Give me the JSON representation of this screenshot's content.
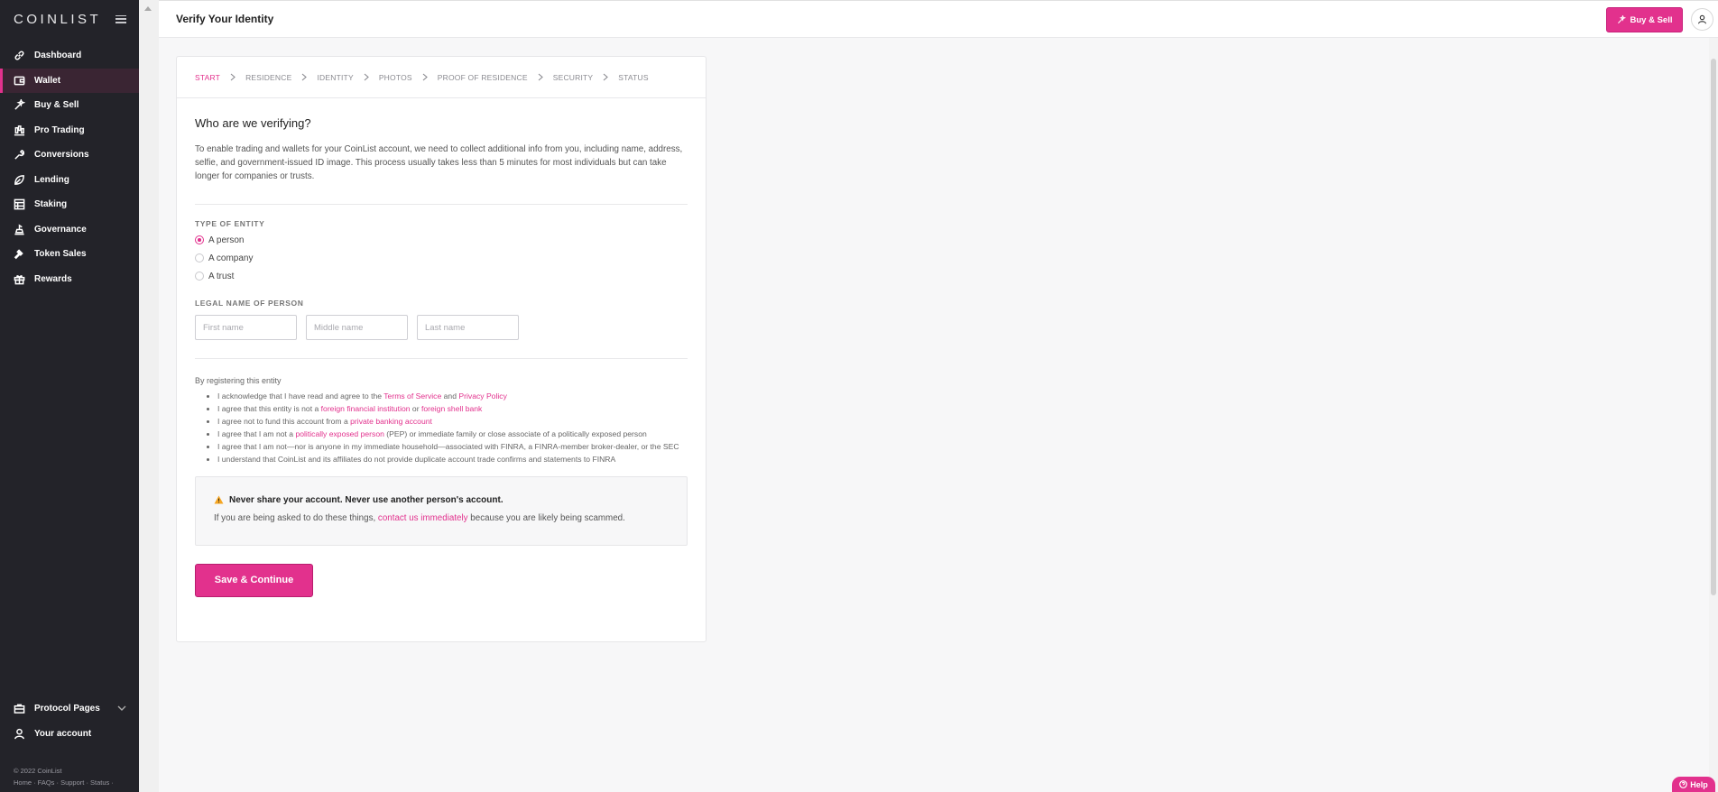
{
  "sidebar": {
    "logo": "COINLIST",
    "items": [
      {
        "label": "Dashboard",
        "icon": "link-icon"
      },
      {
        "label": "Wallet",
        "icon": "wallet-icon",
        "active": true
      },
      {
        "label": "Buy & Sell",
        "icon": "sparkle-icon"
      },
      {
        "label": "Pro Trading",
        "icon": "candlestick-icon"
      },
      {
        "label": "Conversions",
        "icon": "wrench-icon"
      },
      {
        "label": "Lending",
        "icon": "leaf-icon"
      },
      {
        "label": "Staking",
        "icon": "staking-icon"
      },
      {
        "label": "Governance",
        "icon": "governance-icon"
      },
      {
        "label": "Token Sales",
        "icon": "gavel-icon"
      },
      {
        "label": "Rewards",
        "icon": "gift-icon"
      }
    ],
    "protocol_pages": "Protocol Pages",
    "your_account": "Your account",
    "copyright": "© 2022 CoinList",
    "footer_links": "Home · FAQs · Support · Status ·"
  },
  "header": {
    "title": "Verify Your Identity",
    "buy_sell_label": "Buy & Sell"
  },
  "steps": [
    "START",
    "RESIDENCE",
    "IDENTITY",
    "PHOTOS",
    "PROOF OF RESIDENCE",
    "SECURITY",
    "STATUS"
  ],
  "form": {
    "heading": "Who are we verifying?",
    "intro": "To enable trading and wallets for your CoinList account, we need to collect additional info from you, including name, address, selfie, and government-issued ID image. This process usually takes less than 5 minutes for most individuals but can take longer for companies or trusts.",
    "entity_label": "TYPE OF ENTITY",
    "entity_options": [
      "A person",
      "A company",
      "A trust"
    ],
    "name_label": "LEGAL NAME OF PERSON",
    "first_placeholder": "First name",
    "middle_placeholder": "Middle name",
    "last_placeholder": "Last name",
    "registering": "By registering this entity",
    "terms": {
      "t1a": "I acknowledge that I have read and agree to the ",
      "t1_link1": "Terms of Service",
      "t1b": " and ",
      "t1_link2": "Privacy Policy",
      "t2a": "I agree that this entity is not a ",
      "t2_link1": "foreign financial institution",
      "t2b": " or ",
      "t2_link2": "foreign shell bank",
      "t3a": "I agree not to fund this account from a ",
      "t3_link": "private banking account",
      "t4a": "I agree that I am not a ",
      "t4_link": "politically exposed person",
      "t4b": " (PEP) or immediate family or close associate of a politically exposed person",
      "t5": "I agree that I am not—nor is anyone in my immediate household—associated with FINRA, a FINRA-member broker-dealer, or the SEC",
      "t6": "I understand that CoinList and its affiliates do not provide duplicate account trade confirms and statements to FINRA"
    },
    "warning_title": "Never share your account. Never use another person's account.",
    "warning_a": "If you are being asked to do these things, ",
    "warning_link": "contact us immediately",
    "warning_b": " because you are likely being scammed.",
    "save_label": "Save & Continue"
  },
  "help_label": "Help",
  "colors": {
    "accent": "#e2318d",
    "sidebar_bg": "#232329"
  }
}
